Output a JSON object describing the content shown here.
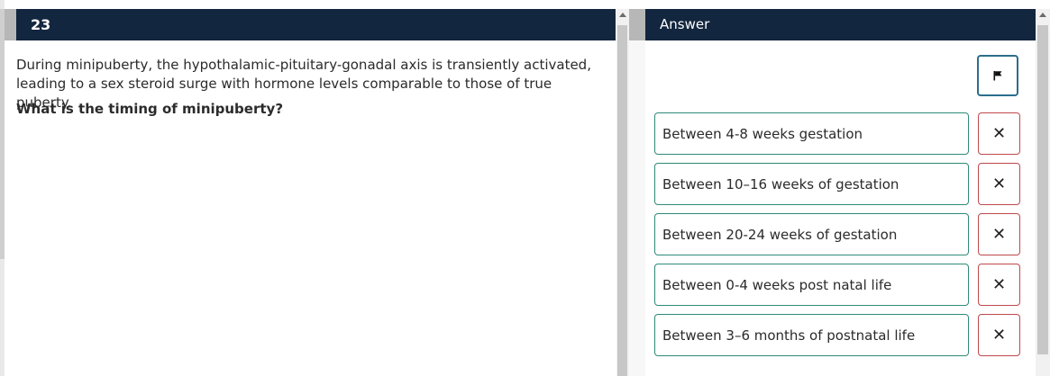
{
  "question": {
    "number": "23",
    "text": "During minipuberty, the hypothalamic-pituitary-gonadal axis is transiently activated, leading to a sex steroid surge with hormone levels comparable to those of true puberty.",
    "prompt": "What is the timing of minipuberty?"
  },
  "answer_panel": {
    "title": "Answer",
    "flag_icon": "flag-icon",
    "options": [
      {
        "label": "Between 4-8 weeks gestation",
        "remove_glyph": "✕"
      },
      {
        "label": "Between 10–16 weeks of gestation",
        "remove_glyph": "✕"
      },
      {
        "label": "Between 20-24 weeks of gestation",
        "remove_glyph": "✕"
      },
      {
        "label": "Between 0-4 weeks post natal life",
        "remove_glyph": "✕"
      },
      {
        "label": "Between 3–6 months of postnatal life",
        "remove_glyph": "✕"
      }
    ]
  },
  "colors": {
    "header_bg": "#13263f",
    "option_border": "#2e8a78",
    "remove_border": "#c0484b",
    "flag_border": "#2c6e8c"
  }
}
